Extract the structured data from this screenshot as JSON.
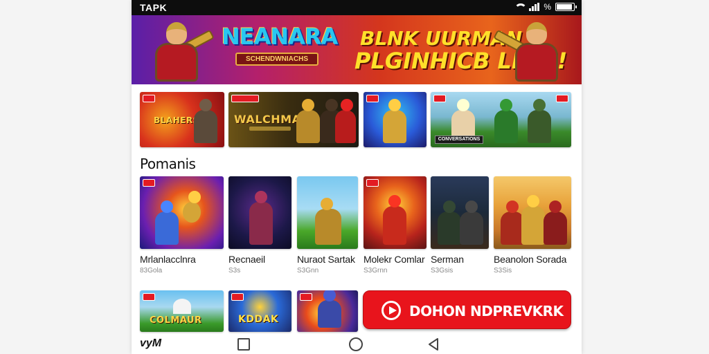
{
  "status_bar": {
    "app_label": "TAPK",
    "battery_level": 0.85
  },
  "banner": {
    "logo_title": "NEANARA",
    "logo_subtitle": "SCHENDWNIACHS",
    "slogan_line1": "BLNK UURMAN",
    "slogan_line2": "PLGINHICB LION!"
  },
  "featured": [
    {
      "title": "BLAHERS"
    },
    {
      "title": "WALCHMAN"
    },
    {
      "title": ""
    },
    {
      "label": "CONVERSATIONS"
    }
  ],
  "section": {
    "title": "Pomanis"
  },
  "games": [
    {
      "name": "Mrlanlacclnra",
      "sub": "83Gola"
    },
    {
      "name": "Recnaeil",
      "sub": "S3s"
    },
    {
      "name": "Nuraot Sartak",
      "sub": "S3Gnn"
    },
    {
      "name": "Molekr Comlar",
      "sub": "S3Grnn"
    },
    {
      "name": "Serman",
      "sub": "S3Gsis"
    },
    {
      "name": "Beanolon Sorada",
      "sub": "S3Sis"
    }
  ],
  "more_games": [
    {
      "title": "COLMAUR"
    },
    {
      "title": "KDDAK"
    },
    {
      "title": ""
    }
  ],
  "download_button": {
    "label": "DOHON NDPREVKRK"
  },
  "nav": {
    "logo": "vyM"
  },
  "colors": {
    "accent": "#e8141c",
    "status_bar": "#0d0d0d",
    "text": "#1a1a1a"
  }
}
